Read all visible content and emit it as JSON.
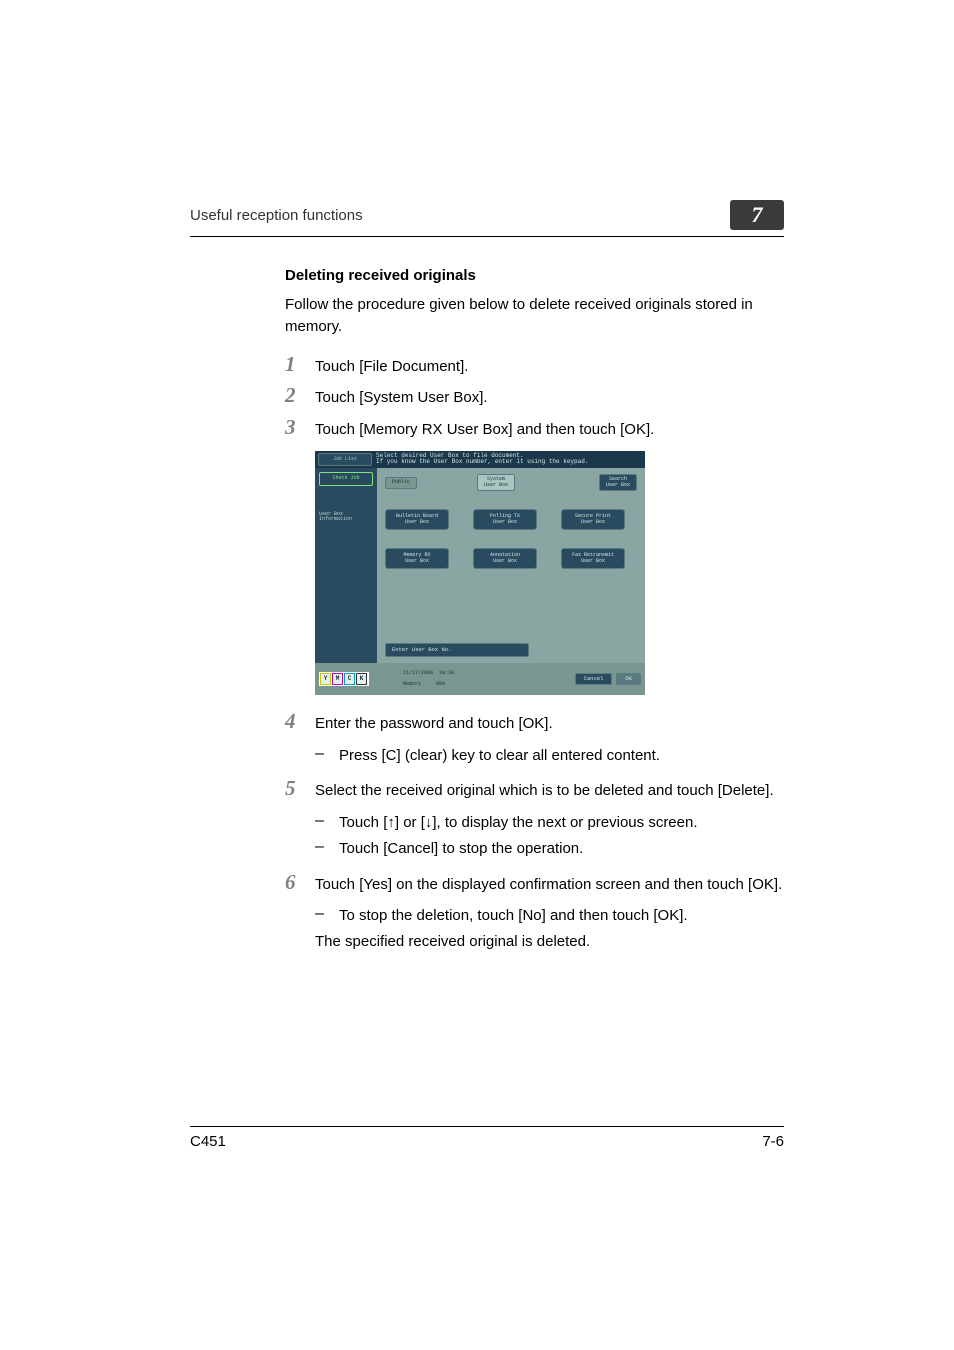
{
  "header": {
    "running_title": "Useful reception functions",
    "chapter_number": "7"
  },
  "section_title": "Deleting received originals",
  "intro": "Follow the procedure given below to delete received originals stored in memory.",
  "steps": {
    "1": "Touch [File Document].",
    "2": "Touch [System User Box].",
    "3": "Touch [Memory RX User Box] and then touch [OK].",
    "4": "Enter the password and touch [OK].",
    "4a": "Press [C] (clear) key to clear all entered content.",
    "5": "Select the received original which is to be deleted and touch [Delete].",
    "5a": "Touch [↑] or [↓], to display the next or previous screen.",
    "5b": "Touch [Cancel] to stop the operation.",
    "6": "Touch [Yes] on the displayed confirmation screen and then touch [OK].",
    "6a": "To stop the deletion, touch [No] and then touch [OK].",
    "6b": "The specified received original is deleted."
  },
  "screen": {
    "header_msg": "Select desired User Box to file document.\nIf you know the User Box number, enter it using the keypad.",
    "sidebar": {
      "job_list": "Job List",
      "check_job": "Check Job",
      "info_label": "User Box\nInformation"
    },
    "tabs": {
      "public": "Public",
      "system": "System\nUser Box",
      "search": "Search\nUser Box"
    },
    "grid": {
      "bulletin": "Bulletin Board\nUser Box",
      "polling": "Polling TX\nUser Box",
      "secure": "Secure Print\nUser Box",
      "memory_rx": "Memory RX\nUser Box",
      "annotation": "Annotation\nUser Box",
      "retransmit": "Fax Retransmit\nUser Box"
    },
    "enter_box": "Enter User Box No.",
    "footer": {
      "date": "11/17/2006",
      "time": "10:39",
      "mem_label": "Memory",
      "mem_val": "99%",
      "cancel": "Cancel",
      "ok": "OK",
      "icons": {
        "y": "Y",
        "m": "M",
        "c": "C",
        "k": "K"
      }
    }
  },
  "footer": {
    "left": "C451",
    "right": "7-6"
  }
}
